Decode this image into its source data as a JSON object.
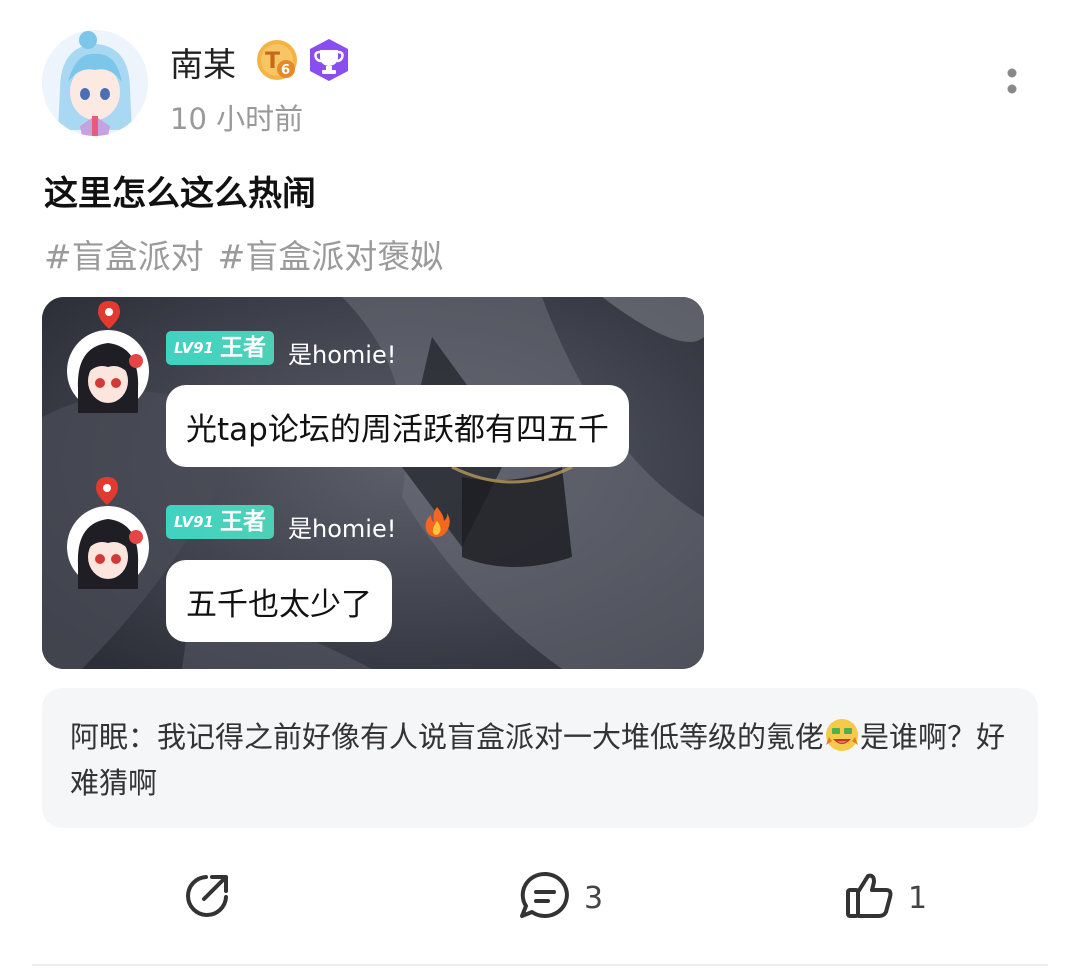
{
  "post": {
    "author": {
      "name": "南某",
      "time": "10 小时前"
    },
    "title": "这里怎么这么热闹",
    "tags": [
      "#盲盒派对",
      "#盲盒派对褒姒"
    ],
    "image": {
      "messages": [
        {
          "level": "LV91",
          "rank": "王者",
          "nickname": "是homie!",
          "text": "光tap论坛的周活跃都有四五千"
        },
        {
          "level": "LV91",
          "rank": "王者",
          "nickname": "是homie!",
          "text": "五千也太少了"
        }
      ]
    },
    "comment": {
      "author": "阿眠",
      "separator": "：",
      "text_before_emoji": "我记得之前好像有人说盲盒派对一大堆低等级的氪佬",
      "text_after_emoji": "是谁啊？好难猜啊"
    },
    "actions": {
      "share_icon": "share-icon",
      "comment_icon": "comment-icon",
      "comment_count": "3",
      "like_icon": "thumbs-up-icon",
      "like_count": "1"
    }
  },
  "colors": {
    "level_badge": "#3fd3c2",
    "tag_text": "#9a9a9a",
    "trophy_badge": "#8a4df0",
    "t6_badge": "#f5b342"
  }
}
